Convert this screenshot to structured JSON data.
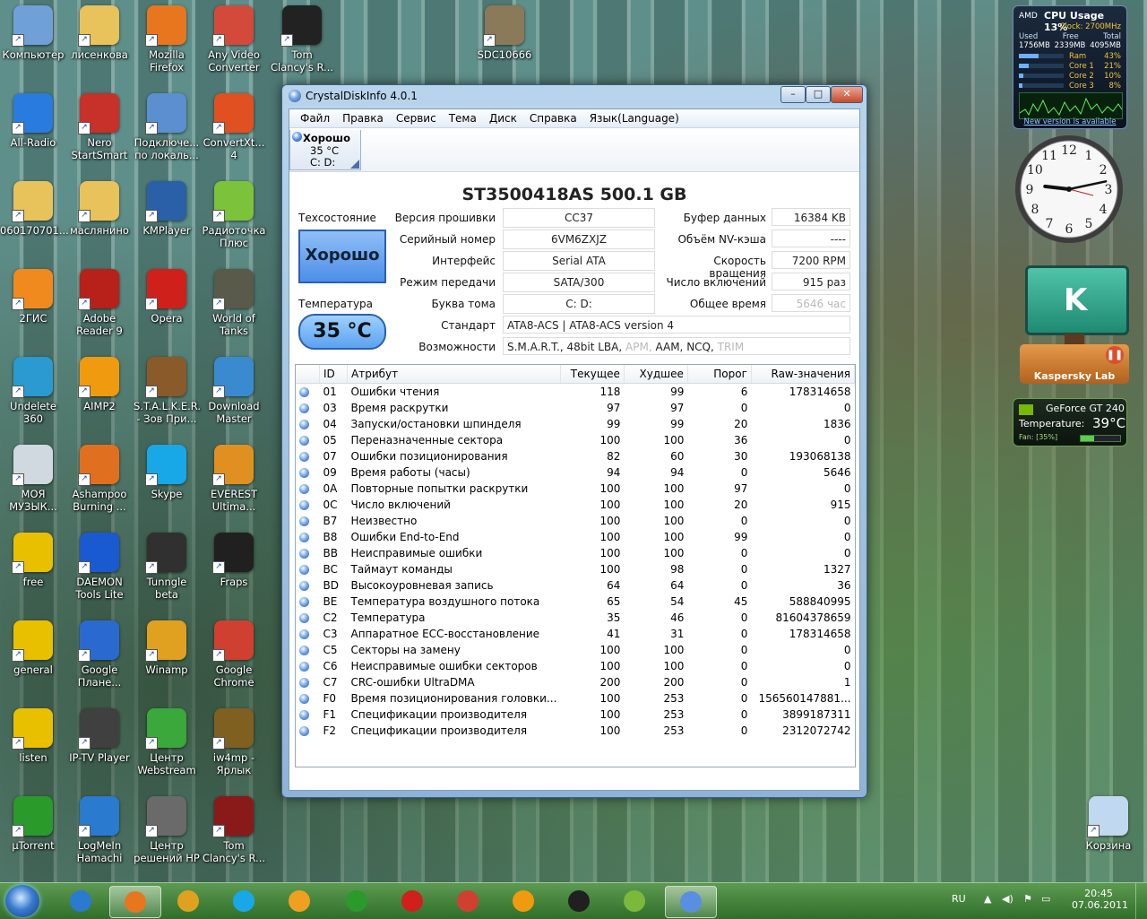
{
  "desktop_icons": [
    {
      "label": "Компьютер",
      "color": "#6fa0d8"
    },
    {
      "label": "лисенкова",
      "color": "#e8c25a"
    },
    {
      "label": "Mozilla Firefox",
      "color": "#e8761f"
    },
    {
      "label": "Any Video Converter",
      "color": "#d44a3a"
    },
    {
      "label": "Tom Clancy's R...",
      "color": "#222222"
    },
    {
      "label": "SDC10666",
      "color": "#8a7a5a"
    },
    {
      "label": "All-Radio",
      "color": "#2a7be0"
    },
    {
      "label": "Nero StartSmart",
      "color": "#c8302a"
    },
    {
      "label": "Подключе... по локаль...",
      "color": "#5b8fd0"
    },
    {
      "label": "ConvertXt... 4",
      "color": "#e05020"
    },
    {
      "label": "060170701...",
      "color": "#e8c25a"
    },
    {
      "label": "маслянино",
      "color": "#e8c25a"
    },
    {
      "label": "KMPlayer",
      "color": "#2a60a8"
    },
    {
      "label": "Радиоточка Плюс",
      "color": "#7cc23a"
    },
    {
      "label": "2ГИС",
      "color": "#f08a1e"
    },
    {
      "label": "Adobe Reader 9",
      "color": "#b8201a"
    },
    {
      "label": "Opera",
      "color": "#d0201c"
    },
    {
      "label": "World of Tanks",
      "color": "#5a5a4a"
    },
    {
      "label": "Undelete 360",
      "color": "#2a9ad0"
    },
    {
      "label": "AIMP2",
      "color": "#f09a10"
    },
    {
      "label": "S.T.A.L.K.E.R. - Зов При...",
      "color": "#8a5a2a"
    },
    {
      "label": "Download Master",
      "color": "#3a8ad0"
    },
    {
      "label": "МОЯ МУЗЫК...",
      "color": "#d0d8e0"
    },
    {
      "label": "Ashampoo Burning ...",
      "color": "#e07020"
    },
    {
      "label": "Skype",
      "color": "#18a8e8"
    },
    {
      "label": "EVEREST Ultima...",
      "color": "#e09020"
    },
    {
      "label": "free",
      "color": "#e8c000"
    },
    {
      "label": "DAEMON Tools Lite",
      "color": "#1a5ad0"
    },
    {
      "label": "Tunngle beta",
      "color": "#303030"
    },
    {
      "label": "Fraps",
      "color": "#202020"
    },
    {
      "label": "general",
      "color": "#e8c000"
    },
    {
      "label": "Google Плане...",
      "color": "#2a6ad0"
    },
    {
      "label": "Winamp",
      "color": "#e0a020"
    },
    {
      "label": "Google Chrome",
      "color": "#d04030"
    },
    {
      "label": "listen",
      "color": "#e8c000"
    },
    {
      "label": "IP-TV Player",
      "color": "#404040"
    },
    {
      "label": "Центр Webstream",
      "color": "#3aa83a"
    },
    {
      "label": "iw4mp - Ярлык",
      "color": "#806020"
    },
    {
      "label": "µTorrent",
      "color": "#2a9a2a"
    },
    {
      "label": "LogMeIn Hamachi",
      "color": "#2a7ad0"
    },
    {
      "label": "Центр решений HP",
      "color": "#6a6a6a"
    },
    {
      "label": "Tom Clancy's R...",
      "color": "#8a1a1a"
    },
    {
      "label": "Корзина",
      "color": "#c0d8f0"
    }
  ],
  "window": {
    "title": "CrystalDiskInfo 4.0.1",
    "controls": {
      "minimize": "–",
      "maximize": "□",
      "close": "✕"
    },
    "menu": [
      "Файл",
      "Правка",
      "Сервис",
      "Тема",
      "Диск",
      "Справка",
      "Язык(Language)"
    ],
    "drive_tab": {
      "status": "Хорошо",
      "temp": "35 °C",
      "letters": "C: D:"
    },
    "model": "ST3500418AS  500.1 GB",
    "health_label": "Техсостояние",
    "health_value": "Хорошо",
    "temp_label": "Температура",
    "temp_value": "35 °C",
    "fields": {
      "firmware_label": "Версия прошивки",
      "firmware": "CC37",
      "serial_label": "Серийный номер",
      "serial": "6VM6ZXJZ",
      "interface_label": "Интерфейс",
      "interface": "Serial ATA",
      "transfer_label": "Режим передачи",
      "transfer": "SATA/300",
      "letter_label": "Буква тома",
      "letter": "C: D:",
      "standard_label": "Стандарт",
      "standard": "ATA8-ACS | ATA8-ACS version 4",
      "features_label": "Возможности",
      "features_a": "S.M.A.R.T., 48bit LBA,",
      "features_b": "APM,",
      "features_c": "AAM, NCQ,",
      "features_d": "TRIM",
      "buffer_label": "Буфер данных",
      "buffer": "16384 KB",
      "nv_label": "Объём NV-кэша",
      "nv": "----",
      "rpm_label": "Скорость вращения",
      "rpm": "7200 RPM",
      "power_count_label": "Число включений",
      "power_count": "915 раз",
      "hours_label": "Общее время",
      "hours": "5646 час"
    },
    "smart_headers": {
      "id": "ID",
      "attr": "Атрибут",
      "cur": "Текущее",
      "worst": "Худшее",
      "thr": "Порог",
      "raw": "Raw-значения"
    },
    "smart_rows": [
      [
        "01",
        "Ошибки чтения",
        "118",
        "99",
        "6",
        "178314658"
      ],
      [
        "03",
        "Время раскрутки",
        "97",
        "97",
        "0",
        "0"
      ],
      [
        "04",
        "Запуски/остановки шпинделя",
        "99",
        "99",
        "20",
        "1836"
      ],
      [
        "05",
        "Переназначенные сектора",
        "100",
        "100",
        "36",
        "0"
      ],
      [
        "07",
        "Ошибки позиционирования",
        "82",
        "60",
        "30",
        "193068138"
      ],
      [
        "09",
        "Время работы (часы)",
        "94",
        "94",
        "0",
        "5646"
      ],
      [
        "0A",
        "Повторные попытки раскрутки",
        "100",
        "100",
        "97",
        "0"
      ],
      [
        "0C",
        "Число включений",
        "100",
        "100",
        "20",
        "915"
      ],
      [
        "B7",
        "Неизвестно",
        "100",
        "100",
        "0",
        "0"
      ],
      [
        "B8",
        "Ошибки End-to-End",
        "100",
        "100",
        "99",
        "0"
      ],
      [
        "BB",
        "Неисправимые ошибки",
        "100",
        "100",
        "0",
        "0"
      ],
      [
        "BC",
        "Таймаут команды",
        "100",
        "98",
        "0",
        "1327"
      ],
      [
        "BD",
        "Высокоуровневая запись",
        "64",
        "64",
        "0",
        "36"
      ],
      [
        "BE",
        "Температура воздушного потока",
        "65",
        "54",
        "45",
        "588840995"
      ],
      [
        "C2",
        "Температура",
        "35",
        "46",
        "0",
        "81604378659"
      ],
      [
        "C3",
        "Аппаратное ECC-восстановление",
        "41",
        "31",
        "0",
        "178314658"
      ],
      [
        "C5",
        "Секторы на замену",
        "100",
        "100",
        "0",
        "0"
      ],
      [
        "C6",
        "Неисправимые ошибки секторов",
        "100",
        "100",
        "0",
        "0"
      ],
      [
        "C7",
        "CRC-ошибки UltraDMA",
        "200",
        "200",
        "0",
        "1"
      ],
      [
        "F0",
        "Время позиционирования головки...",
        "100",
        "253",
        "0",
        "156560147881..."
      ],
      [
        "F1",
        "Спецификации производителя",
        "100",
        "253",
        "0",
        "3899187311"
      ],
      [
        "F2",
        "Спецификации производителя",
        "100",
        "253",
        "0",
        "2312072742"
      ]
    ]
  },
  "gadgets": {
    "cpu": {
      "title": "CPU Usage",
      "percent": "13%",
      "vendor": "AMD",
      "clock": "Clock: 2700MHz",
      "mem_used_label": "Used",
      "mem_free_label": "Free",
      "mem_total_label": "Total",
      "mem_used": "1756MB",
      "mem_free": "2339MB",
      "mem_total": "4095MB",
      "ram_label": "Ram",
      "ram": "43%",
      "core1_label": "Core 1",
      "core1": "21%",
      "core2_label": "Core 2",
      "core2": "10%",
      "core3_label": "Core 3",
      "core3": "8%",
      "new_version": "New version is available"
    },
    "clock": {
      "time_hour": 9,
      "time_minute": 13,
      "numbers": [
        "12",
        "1",
        "2",
        "3",
        "4",
        "5",
        "6",
        "7",
        "8",
        "9",
        "10",
        "11"
      ]
    },
    "kaspersky": {
      "label": "Kaspersky Lab"
    },
    "gpu": {
      "name": "GeForce GT 240",
      "temp_label": "Temperature:",
      "temp": "39°C",
      "fan": "Fan: [35%]",
      "fan_percent": 35
    }
  },
  "taskbar": {
    "language": "RU",
    "time": "20:45",
    "date": "07.06.2011",
    "items": [
      {
        "name": "ie",
        "color": "#2a7ad0"
      },
      {
        "name": "firefox",
        "color": "#e8761f",
        "active": true
      },
      {
        "name": "winamp",
        "color": "#e0a020"
      },
      {
        "name": "skype",
        "color": "#18a8e8"
      },
      {
        "name": "mail-agent",
        "color": "#f0a020"
      },
      {
        "name": "utorrent",
        "color": "#2a9a2a"
      },
      {
        "name": "opera",
        "color": "#d0201c"
      },
      {
        "name": "chrome",
        "color": "#d04030"
      },
      {
        "name": "aimp",
        "color": "#f09a10"
      },
      {
        "name": "game",
        "color": "#202020"
      },
      {
        "name": "leaf",
        "color": "#7cb83a"
      },
      {
        "name": "crystaldiskinfo",
        "color": "#5a8ee0",
        "active": true
      }
    ]
  }
}
